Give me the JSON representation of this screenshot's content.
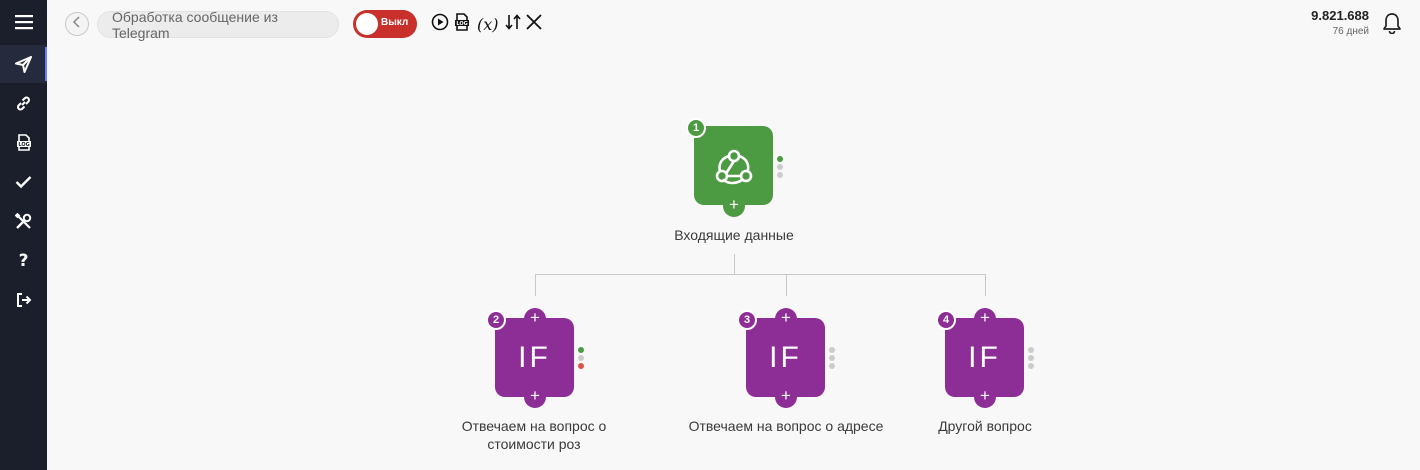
{
  "header": {
    "scenario_title": "Обработка сообщение из Telegram",
    "toggle_label": "Выкл",
    "var_icon_label": "(x)",
    "balance_amount": "9.821.688",
    "balance_days": "76 дней"
  },
  "sidebar": {
    "items": [
      {
        "name": "menu-icon"
      },
      {
        "name": "send-icon",
        "active": true
      },
      {
        "name": "link-icon"
      },
      {
        "name": "log-icon"
      },
      {
        "name": "check-icon"
      },
      {
        "name": "tools-icon"
      },
      {
        "name": "help-icon",
        "text": "?"
      },
      {
        "name": "logout-icon"
      }
    ]
  },
  "nodes": [
    {
      "number": "1",
      "type": "webhook",
      "label": "Входящие данные",
      "color": "#4c9a42"
    },
    {
      "number": "2",
      "type": "if",
      "icon_text": "IF",
      "label_line1": "Отвечаем на вопрос о",
      "label_line2": "стоимости роз",
      "color": "#8d2e96"
    },
    {
      "number": "3",
      "type": "if",
      "icon_text": "IF",
      "label": "Отвечаем на вопрос о адресе",
      "color": "#8d2e96"
    },
    {
      "number": "4",
      "type": "if",
      "icon_text": "IF",
      "label": "Другой вопрос",
      "color": "#8d2e96"
    }
  ],
  "colors": {
    "sidebar_bg": "#1b1f2b",
    "toggle_off": "#c9302c",
    "webhook_node": "#4c9a42",
    "if_node": "#8d2e96",
    "status_green": "#4c9a42",
    "status_red": "#d9534f",
    "status_gray": "#cccccc"
  }
}
